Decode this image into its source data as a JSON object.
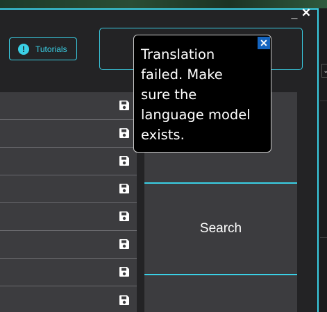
{
  "window": {
    "minimize_label": "_",
    "close_label": "✕"
  },
  "toolbar": {
    "tutorials_label": "Tutorials",
    "tutorials_icon": "info-icon"
  },
  "tooltip": {
    "message": "Translation failed. Make sure the language model exists.",
    "close_label": "✕"
  },
  "list": {
    "row_count": 8,
    "row_icon": "save-icon"
  },
  "side_panel": {
    "search_label": "Search"
  },
  "colors": {
    "accent": "#3ad0e6",
    "panel": "#3c3c3f",
    "background": "#232325",
    "tooltip_bg": "#000000",
    "tooltip_close": "#1565c0"
  }
}
